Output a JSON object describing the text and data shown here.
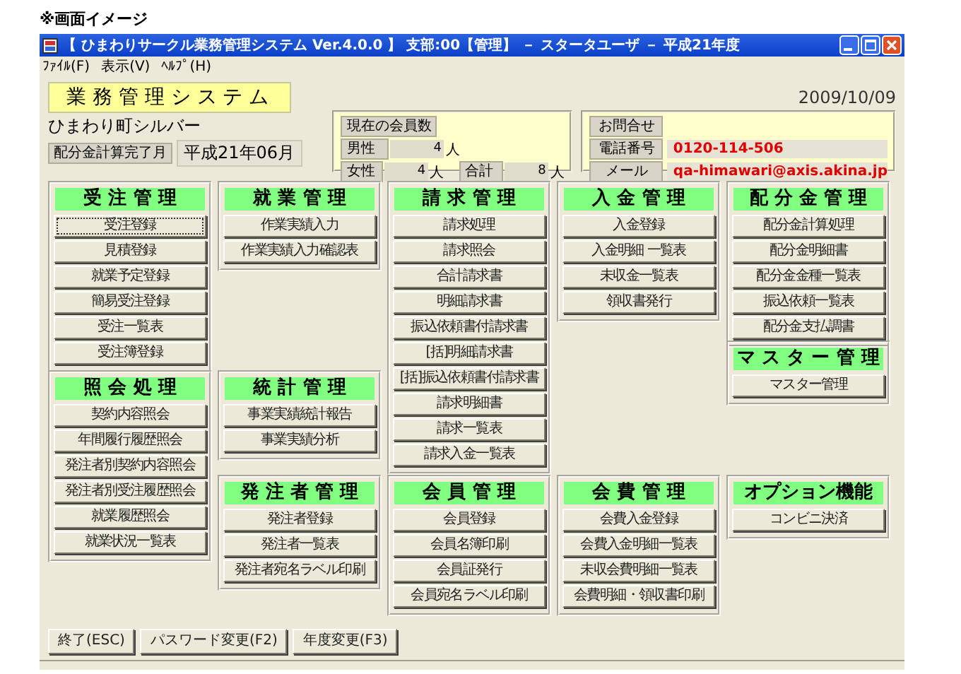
{
  "caption": "※画面イメージ",
  "window": {
    "title": "【 ひまわりサークル業務管理システム Ver.4.0.0 】 支部:00【管理】 － スタータユーザ － 平成21年度"
  },
  "menu": [
    "ﾌｧｲﾙ(F)",
    "表示(V)",
    "ﾍﾙﾌﾟ(H)"
  ],
  "header": {
    "system_title": "業 務 管 理 シ ス テ ム",
    "organization": "ひまわり町シルバー",
    "completed_month": {
      "label": "配分金計算完了月",
      "value": "平成21年06月"
    },
    "date": "2009/10/09"
  },
  "members": {
    "heading": "現在の会員数",
    "rows": [
      {
        "label": "男性",
        "value": "4",
        "unit": "人"
      },
      {
        "label": "女性",
        "value": "4",
        "unit": "人"
      }
    ],
    "total": {
      "label": "合計",
      "value": "8",
      "unit": "人"
    }
  },
  "contact": {
    "heading": "お問合せ",
    "rows": [
      {
        "label": "電話番号",
        "value": "0120-114-506"
      },
      {
        "label": "メール",
        "value": "qa-himawari@axis.akina.jp"
      }
    ]
  },
  "columns": [
    [
      {
        "title": "受 注 管 理",
        "buttons": [
          {
            "label": "受注登録",
            "focused": true
          },
          {
            "label": "見積登録",
            "focused": false
          },
          {
            "label": "就業予定登録",
            "focused": false
          },
          {
            "label": "簡易受注登録",
            "focused": false
          },
          {
            "label": "受注一覧表",
            "focused": false
          },
          {
            "label": "受注簿登録",
            "focused": false
          }
        ]
      },
      {
        "title": "照 会 処 理",
        "buttons": [
          {
            "label": "契約内容照会",
            "focused": false
          },
          {
            "label": "年間履行履歴照会",
            "focused": false
          },
          {
            "label": "発注者別契約内容照会",
            "focused": false
          },
          {
            "label": "発注者別受注履歴照会",
            "focused": false
          },
          {
            "label": "就業履歴照会",
            "focused": false
          },
          {
            "label": "就業状況一覧表",
            "focused": false
          }
        ]
      }
    ],
    [
      {
        "title": "就 業 管 理",
        "buttons": [
          {
            "label": "作業実績入力",
            "focused": false
          },
          {
            "label": "作業実績入力確認表",
            "focused": false
          }
        ]
      },
      {
        "title": "統 計 管 理",
        "buttons": [
          {
            "label": "事業実績統計報告",
            "focused": false
          },
          {
            "label": "事業実績分析",
            "focused": false
          }
        ]
      },
      {
        "title": "発 注 者 管 理",
        "buttons": [
          {
            "label": "発注者登録",
            "focused": false
          },
          {
            "label": "発注者一覧表",
            "focused": false
          },
          {
            "label": "発注者宛名ラベル印刷",
            "focused": false
          }
        ]
      }
    ],
    [
      {
        "title": "請 求 管 理",
        "buttons": [
          {
            "label": "請求処理",
            "focused": false
          },
          {
            "label": "請求照会",
            "focused": false
          },
          {
            "label": "合計請求書",
            "focused": false
          },
          {
            "label": "明細請求書",
            "focused": false
          },
          {
            "label": "振込依頼書付請求書",
            "focused": false
          },
          {
            "label": "[括]明細請求書",
            "focused": false
          },
          {
            "label": "[括]振込依頼書付請求書",
            "focused": false
          },
          {
            "label": "請求明細書",
            "focused": false
          },
          {
            "label": "請求一覧表",
            "focused": false
          },
          {
            "label": "請求入金一覧表",
            "focused": false
          }
        ]
      },
      {
        "title": "会 員 管 理",
        "buttons": [
          {
            "label": "会員登録",
            "focused": false
          },
          {
            "label": "会員名簿印刷",
            "focused": false
          },
          {
            "label": "会員証発行",
            "focused": false
          },
          {
            "label": "会員宛名ラベル印刷",
            "focused": false
          }
        ]
      }
    ],
    [
      {
        "title": "入 金 管 理",
        "buttons": [
          {
            "label": "入金登録",
            "focused": false
          },
          {
            "label": "入金明細 一覧表",
            "focused": false
          },
          {
            "label": "未収金一覧表",
            "focused": false
          },
          {
            "label": "領収書発行",
            "focused": false
          }
        ]
      },
      {
        "title": "会 費 管 理",
        "buttons": [
          {
            "label": "会費入金登録",
            "focused": false
          },
          {
            "label": "会費入金明細一覧表",
            "focused": false
          },
          {
            "label": "未収会費明細一覧表",
            "focused": false
          },
          {
            "label": "会費明細・領収書印刷",
            "focused": false
          }
        ]
      }
    ],
    [
      {
        "title": "配 分 金 管 理",
        "buttons": [
          {
            "label": "配分金計算処理",
            "focused": false
          },
          {
            "label": "配分金明細書",
            "focused": false
          },
          {
            "label": "配分金金種一覧表",
            "focused": false
          },
          {
            "label": "振込依頼一覧表",
            "focused": false
          },
          {
            "label": "配分金支払調書",
            "focused": false
          }
        ]
      },
      {
        "title": "マ ス タ ー 管 理",
        "buttons": [
          {
            "label": "マスター管理",
            "focused": false
          }
        ]
      },
      {
        "title": "オプション機能",
        "buttons": [
          {
            "label": "コンビニ決済",
            "focused": false
          }
        ]
      }
    ]
  ],
  "footer_buttons": [
    "終了(ESC)",
    "パスワード変更(F2)",
    "年度変更(F3)"
  ]
}
